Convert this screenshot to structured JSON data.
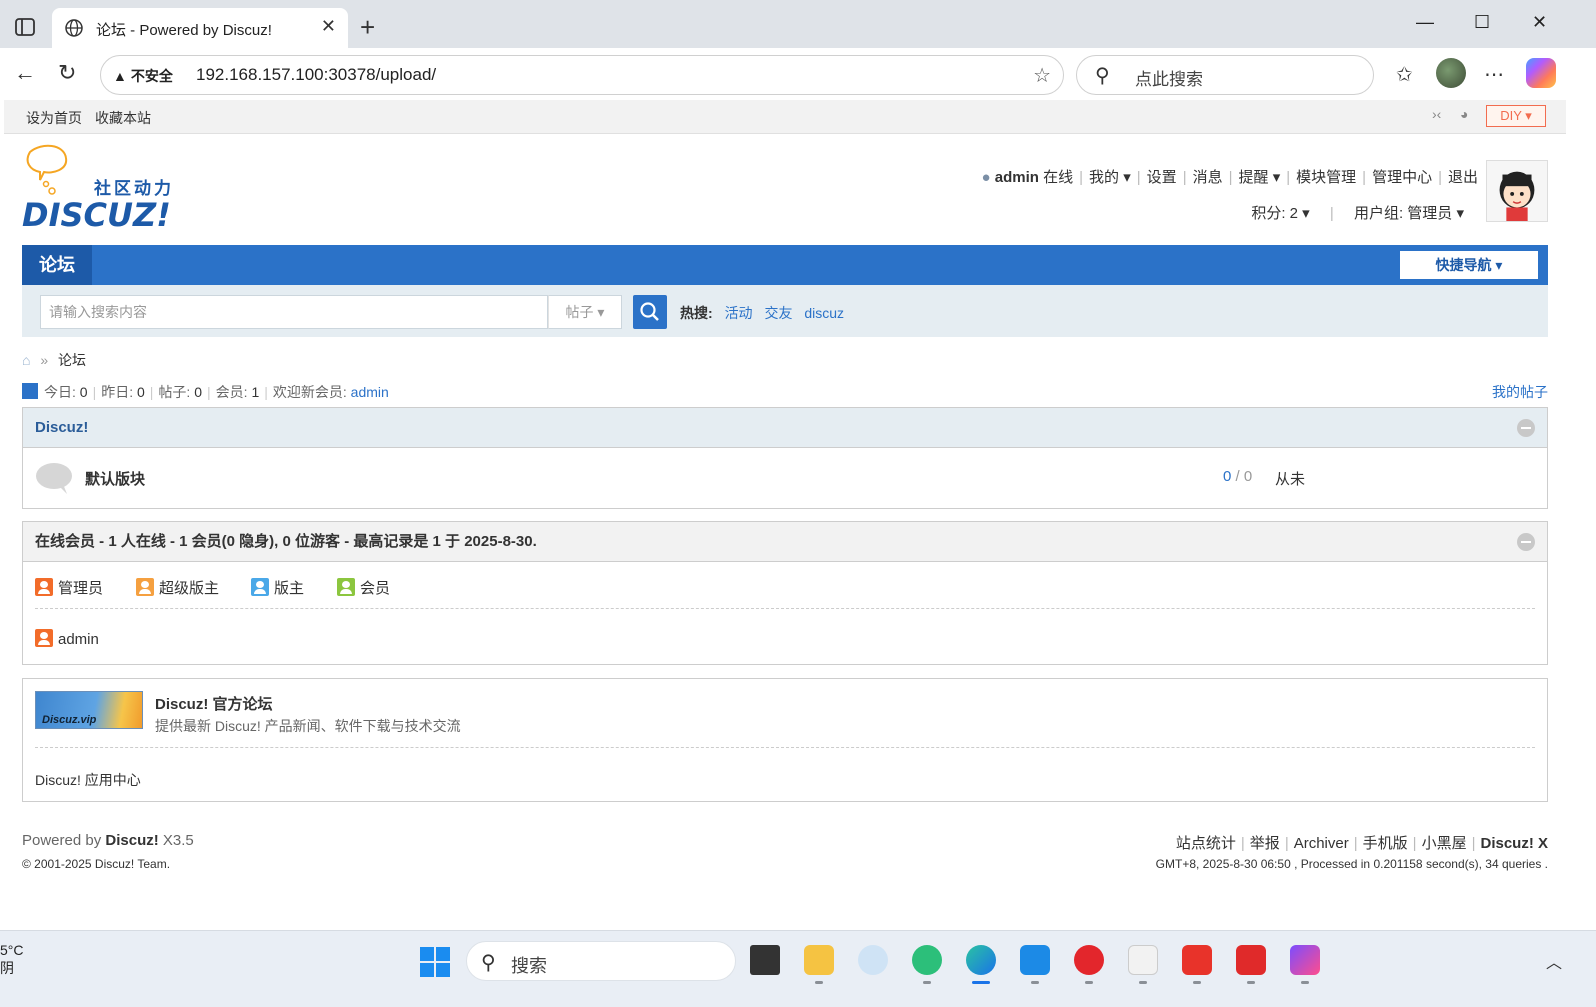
{
  "browser": {
    "tab_title": "论坛 - Powered by Discuz!",
    "insecure_label": "不安全",
    "url": "192.168.157.100:30378/upload/",
    "search_placeholder": "点此搜索"
  },
  "topbar": {
    "set_home": "设为首页",
    "bookmark": "收藏本站",
    "diy": "DIY"
  },
  "header": {
    "logo_text_cn": "社区动力",
    "logo_text_en": "DISCUZ!",
    "username": "admin",
    "online_status": "在线",
    "my": "我的",
    "settings": "设置",
    "messages": "消息",
    "reminders": "提醒",
    "module_manage": "模块管理",
    "admin_center": "管理中心",
    "logout": "退出",
    "credits": "积分: 2",
    "usergroup": "用户组: 管理员"
  },
  "nav": {
    "forum": "论坛",
    "quick_nav": "快捷导航"
  },
  "search": {
    "placeholder": "请输入搜索内容",
    "type": "帖子",
    "hot_label": "热搜:",
    "hot_terms": [
      "活动",
      "交友",
      "discuz"
    ]
  },
  "breadcrumb": {
    "current": "论坛"
  },
  "stats": {
    "today_label": "今日:",
    "today": "0",
    "yesterday_label": "昨日:",
    "yesterday": "0",
    "posts_label": "帖子:",
    "posts": "0",
    "members_label": "会员:",
    "members": "1",
    "welcome_label": "欢迎新会员:",
    "newest_member": "admin",
    "my_posts": "我的帖子"
  },
  "category": {
    "title": "Discuz!",
    "forums": [
      {
        "name": "默认版块",
        "threads": "0",
        "posts": "0",
        "last_post": "从未"
      }
    ]
  },
  "online": {
    "title": "在线会员 - 1 人在线 - 1 会员(0 隐身), 0 位游客 - 最高记录是 1 于 2025-8-30.",
    "legend": [
      {
        "label": "管理员",
        "color": "#f26c2a"
      },
      {
        "label": "超级版主",
        "color": "#f5a040"
      },
      {
        "label": "版主",
        "color": "#4aa8e8"
      },
      {
        "label": "会员",
        "color": "#8cc63f"
      }
    ],
    "users": [
      "admin"
    ]
  },
  "links": {
    "partner_name": "Discuz! 官方论坛",
    "partner_desc": "提供最新 Discuz! 产品新闻、软件下载与技术交流",
    "partner_logo_text": "Discuz.vip",
    "app_center": "Discuz! 应用中心"
  },
  "footer": {
    "powered_prefix": "Powered by",
    "powered_name": "Discuz!",
    "version": "X3.5",
    "copyright": "© 2001-2025 Discuz! Team.",
    "links": [
      "站点统计",
      "举报",
      "Archiver",
      "手机版",
      "小黑屋"
    ],
    "brand": "Discuz! X",
    "processed": "GMT+8, 2025-8-30 06:50 , Processed in 0.201158 second(s), 34 queries ."
  },
  "taskbar": {
    "weather_temp": "5°C",
    "weather_line2": "阴",
    "search_label": "搜索"
  }
}
